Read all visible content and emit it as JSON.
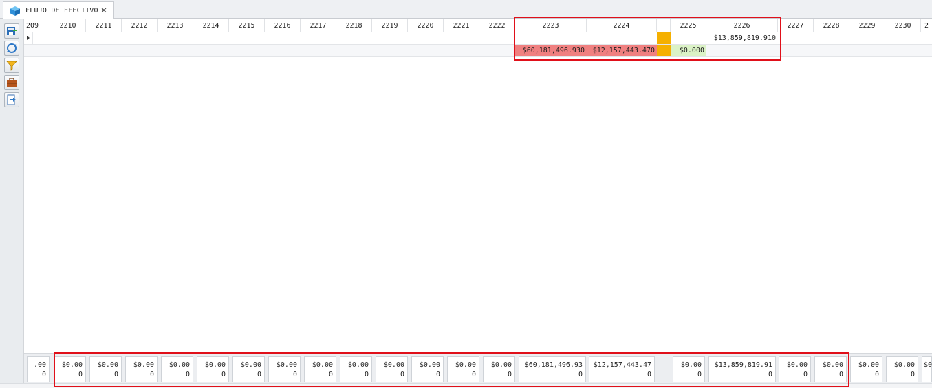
{
  "tab": {
    "label": "FLUJO DE EFECTIVO",
    "close_glyph": "✕"
  },
  "toolbar": {
    "buttons": [
      {
        "icon": "save-export-icon"
      },
      {
        "icon": "refresh-icon"
      },
      {
        "icon": "filter-icon"
      },
      {
        "icon": "briefcase-icon"
      },
      {
        "icon": "export-arrow-icon"
      }
    ]
  },
  "grid": {
    "columns": [
      "209",
      "2210",
      "2211",
      "2212",
      "2213",
      "2214",
      "2215",
      "2216",
      "2217",
      "2218",
      "2219",
      "2220",
      "2221",
      "2222",
      "2223",
      "2224",
      "",
      "2225",
      "2226",
      "2227",
      "2228",
      "2229",
      "2230",
      "2"
    ],
    "row1": {
      "c2226": "$13,859,819.910"
    },
    "row2": {
      "c2223": "$60,181,496.930",
      "c2224": "$12,157,443.470",
      "c2225": "$0.000"
    }
  },
  "footer": {
    "totals": [
      ".00\n0",
      "$0.00\n0",
      "$0.00\n0",
      "$0.00\n0",
      "$0.00\n0",
      "$0.00\n0",
      "$0.00\n0",
      "$0.00\n0",
      "$0.00\n0",
      "$0.00\n0",
      "$0.00\n0",
      "$0.00\n0",
      "$0.00\n0",
      "$0.00\n0",
      "$60,181,496.93\n0",
      "$12,157,443.47\n0",
      "$0.00\n0",
      "$13,859,819.91\n0",
      "$0.00\n0",
      "$0.00\n0",
      "$0.00\n0",
      "$0.00\n0",
      "$0"
    ]
  },
  "colors": {
    "negative": "#f08080",
    "warning": "#f5b000",
    "positive": "#dbf2c6",
    "highlight": "#e0101a"
  }
}
